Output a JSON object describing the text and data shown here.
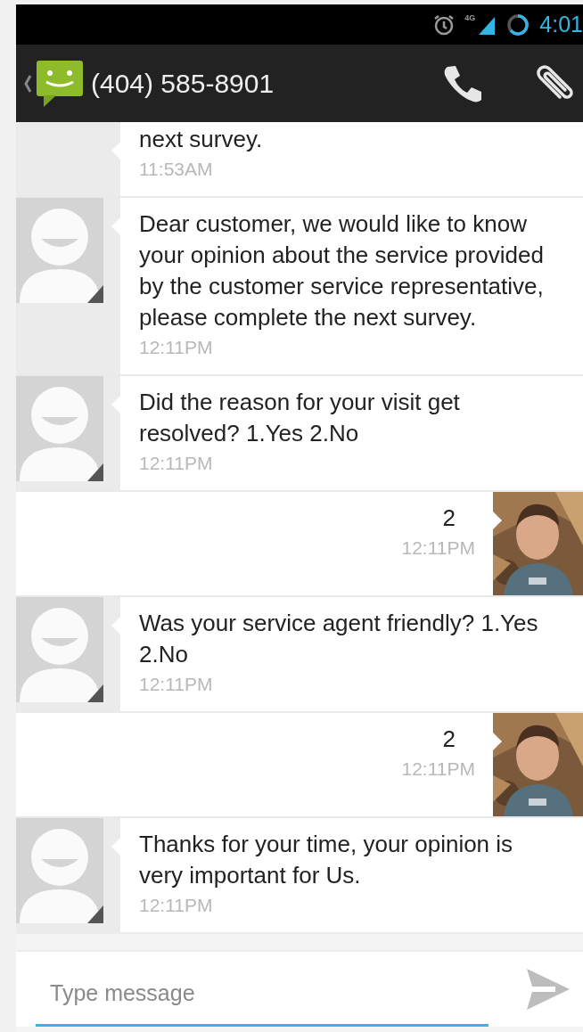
{
  "status_bar": {
    "network": "4G",
    "time": "4:01"
  },
  "conversation": {
    "title": "(404) 585-8901"
  },
  "messages": [
    {
      "kind": "incoming",
      "avatar": false,
      "text": "next survey.",
      "time": "11:53AM"
    },
    {
      "kind": "incoming",
      "avatar": true,
      "text": "Dear customer, we would like to know your opinion about the service provided by the customer service representative, please complete the next survey.",
      "time": "12:11PM"
    },
    {
      "kind": "incoming",
      "avatar": true,
      "text": "Did the reason for your visit get resolved? 1.Yes 2.No",
      "time": "12:11PM"
    },
    {
      "kind": "outgoing",
      "avatar": true,
      "text": "2",
      "time": "12:11PM"
    },
    {
      "kind": "incoming",
      "avatar": true,
      "text": "Was your service agent friendly? 1.Yes 2.No",
      "time": "12:11PM"
    },
    {
      "kind": "outgoing",
      "avatar": true,
      "text": "2",
      "time": "12:11PM"
    },
    {
      "kind": "incoming",
      "avatar": true,
      "text": "Thanks for your time, your opinion is very important for Us.",
      "time": "12:11PM"
    }
  ],
  "composer": {
    "placeholder": "Type message"
  }
}
